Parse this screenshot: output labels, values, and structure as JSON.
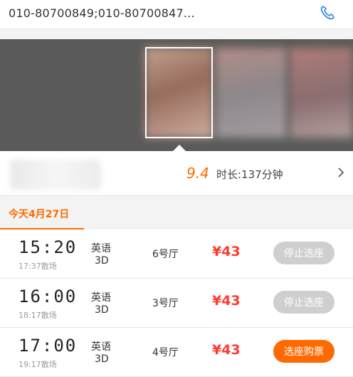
{
  "cinema": {
    "phones": "010-80700849;010-80700847..."
  },
  "movie": {
    "score": "9.4",
    "duration": "时长:137分钟"
  },
  "date_tab": {
    "label": "今天4月27日"
  },
  "showtimes": [
    {
      "start": "15:20",
      "end": "17:37散场",
      "language": "英语",
      "format": "3D",
      "hall": "6号厅",
      "price": "¥43",
      "button": "停止选座",
      "state": "disabled"
    },
    {
      "start": "16:00",
      "end": "18:17散场",
      "language": "英语",
      "format": "3D",
      "hall": "3号厅",
      "price": "¥43",
      "button": "停止选座",
      "state": "disabled"
    },
    {
      "start": "17:00",
      "end": "19:17散场",
      "language": "英语",
      "format": "3D",
      "hall": "4号厅",
      "price": "¥43",
      "button": "选座购票",
      "state": "active"
    }
  ],
  "colors": {
    "accent": "#ff6a00",
    "price": "#ff3b30",
    "disabled_button": "#cfcfcf"
  },
  "icons": {
    "phone": "phone-icon",
    "chevron": "chevron-right-icon"
  }
}
